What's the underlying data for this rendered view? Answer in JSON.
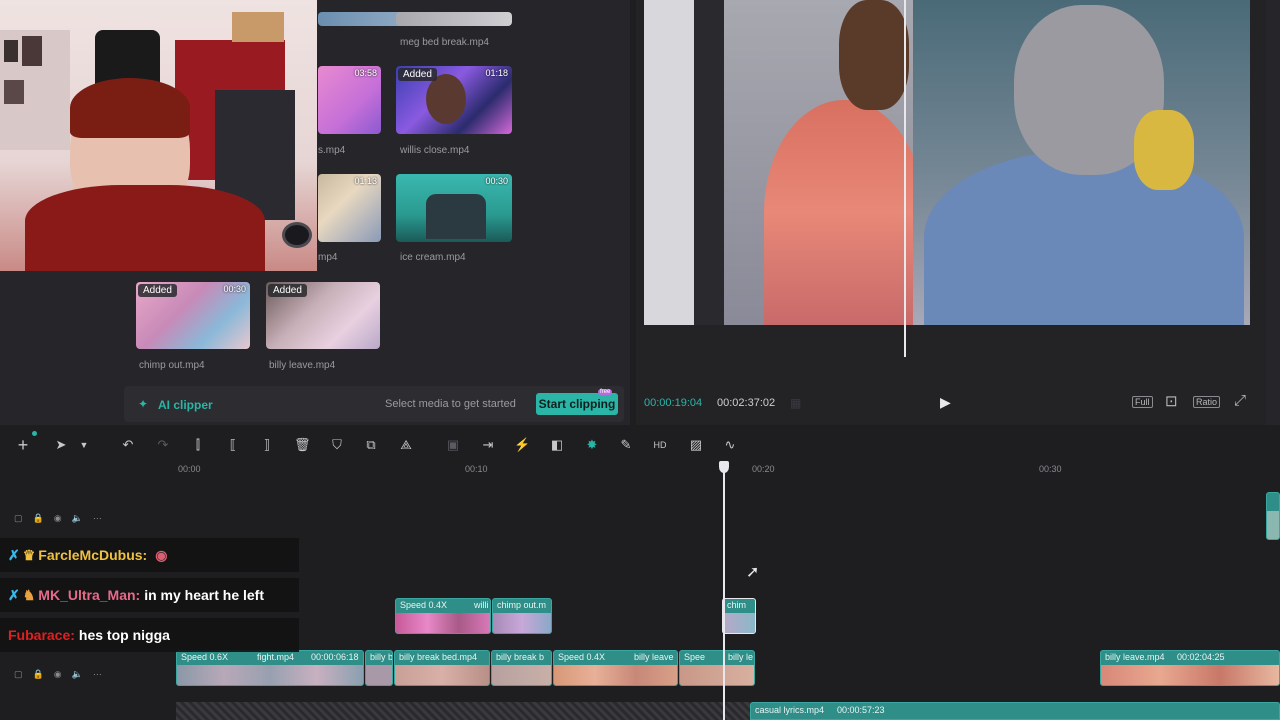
{
  "media": {
    "items": [
      {
        "name": "meg bed break.mp4",
        "duration": "",
        "added": false
      },
      {
        "name": "s.mp4",
        "duration": "03:58",
        "added": false
      },
      {
        "name": "willis close.mp4",
        "duration": "01:18",
        "added": true
      },
      {
        "name": "mp4",
        "duration": "01:13",
        "added": false
      },
      {
        "name": "ice cream.mp4",
        "duration": "00:30",
        "added": false
      },
      {
        "name": "chimp out.mp4",
        "duration": "00:30",
        "added": true
      },
      {
        "name": "billy leave.mp4",
        "duration": "",
        "added": true
      }
    ],
    "added_label": "Added",
    "ai_clipper": "AI clipper",
    "hint": "Select media to get started",
    "start_button": "Start clipping",
    "start_badge": "free"
  },
  "preview": {
    "current_time": "00:00:19:04",
    "total_time": "00:02:37:02",
    "full_label": "Full",
    "ratio_label": "Ratio"
  },
  "timeline": {
    "ticks": [
      "00:00",
      "00:10",
      "00:20",
      "00:30"
    ],
    "clips_row1": [
      {
        "speed": "Speed 0.4X",
        "name": "willi"
      },
      {
        "speed": "",
        "name": "chimp out.m"
      },
      {
        "speed": "",
        "name": "chim"
      }
    ],
    "clips_row2": [
      {
        "speed": "Speed 0.6X",
        "name": "fight.mp4",
        "time": "00:00:06:18"
      },
      {
        "speed": "",
        "name": "billy b",
        "time": ""
      },
      {
        "speed": "",
        "name": "billy break bed.mp4",
        "time": ""
      },
      {
        "speed": "",
        "name": "billy break b",
        "time": ""
      },
      {
        "speed": "Speed 0.4X",
        "name": "billy leave",
        "time": ""
      },
      {
        "speed": "Spee",
        "name": "billy le",
        "time": ""
      },
      {
        "speed": "",
        "name": "billy leave.mp4",
        "time": "00:02:04:25"
      }
    ],
    "audio_clip": {
      "name": "casual lyrics.mp4",
      "time": "00:00:57:23"
    }
  },
  "chat": [
    {
      "user": "FarcleMcDubus:",
      "message": "",
      "color": "#f0c040"
    },
    {
      "user": "MK_Ultra_Man:",
      "message": "in my heart he left",
      "color": "#e86a8a"
    },
    {
      "user": "Fubarace:",
      "message": "hes top nigga",
      "color": "#e02020"
    }
  ],
  "colors": {
    "accent": "#2bb5a6",
    "clip": "#2f8e88"
  }
}
